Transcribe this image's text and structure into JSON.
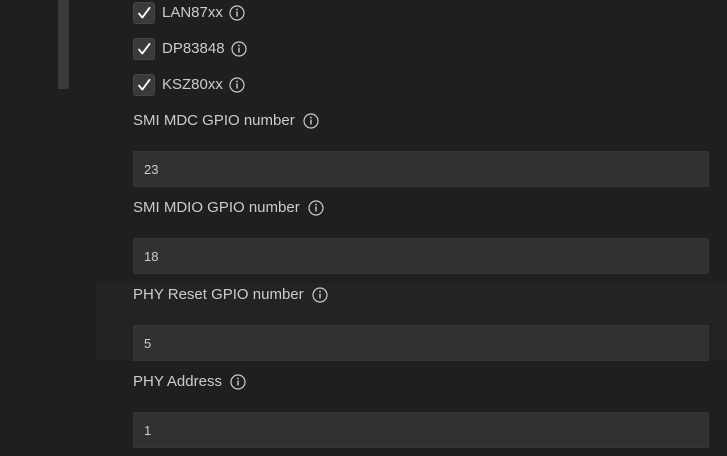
{
  "phy_checkboxes": [
    {
      "label": "LAN87xx",
      "checked": true
    },
    {
      "label": "DP83848",
      "checked": true
    },
    {
      "label": "KSZ80xx",
      "checked": true
    }
  ],
  "fields": [
    {
      "label": "SMI MDC GPIO number",
      "value": "23"
    },
    {
      "label": "SMI MDIO GPIO number",
      "value": "18"
    },
    {
      "label": "PHY Reset GPIO number",
      "value": "5"
    },
    {
      "label": "PHY Address",
      "value": "1"
    }
  ],
  "icons": {
    "checkmark": "checkmark-icon",
    "info": "info-icon"
  },
  "colors": {
    "background": "#1f1f1f",
    "input_background": "#313131",
    "text": "#cccccc",
    "hover_band": "#232323"
  }
}
